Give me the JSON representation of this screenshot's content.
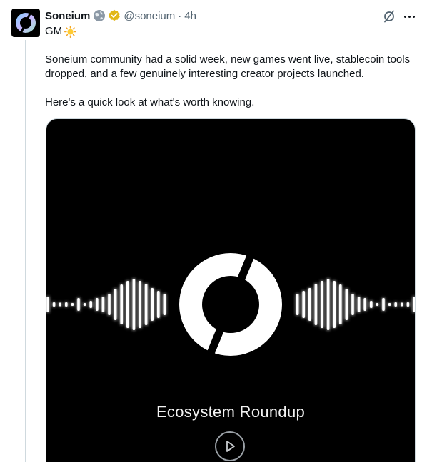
{
  "post": {
    "display_name": "Soneium",
    "handle": "@soneium",
    "separator": "·",
    "time": "4h",
    "greeting": "GM",
    "paragraph_1": "Soneium community had a solid week, new games went live, stablecoin tools dropped, and a few genuinely interesting creator projects launched.",
    "paragraph_2": "Here's a quick look at what's worth knowing."
  },
  "media": {
    "title": "Ecosystem Roundup"
  },
  "icons": {
    "globe": "globe-icon",
    "verified": "verified-badge-icon",
    "sun": "sun-emoji-icon",
    "grok": "grok-icon",
    "more": "more-icon",
    "play": "play-icon"
  },
  "colors": {
    "text": "#0f1419",
    "secondary": "#536471",
    "verified_gold": "#e2b719",
    "thread_line": "#cfd9de",
    "media_bg": "#000000"
  }
}
